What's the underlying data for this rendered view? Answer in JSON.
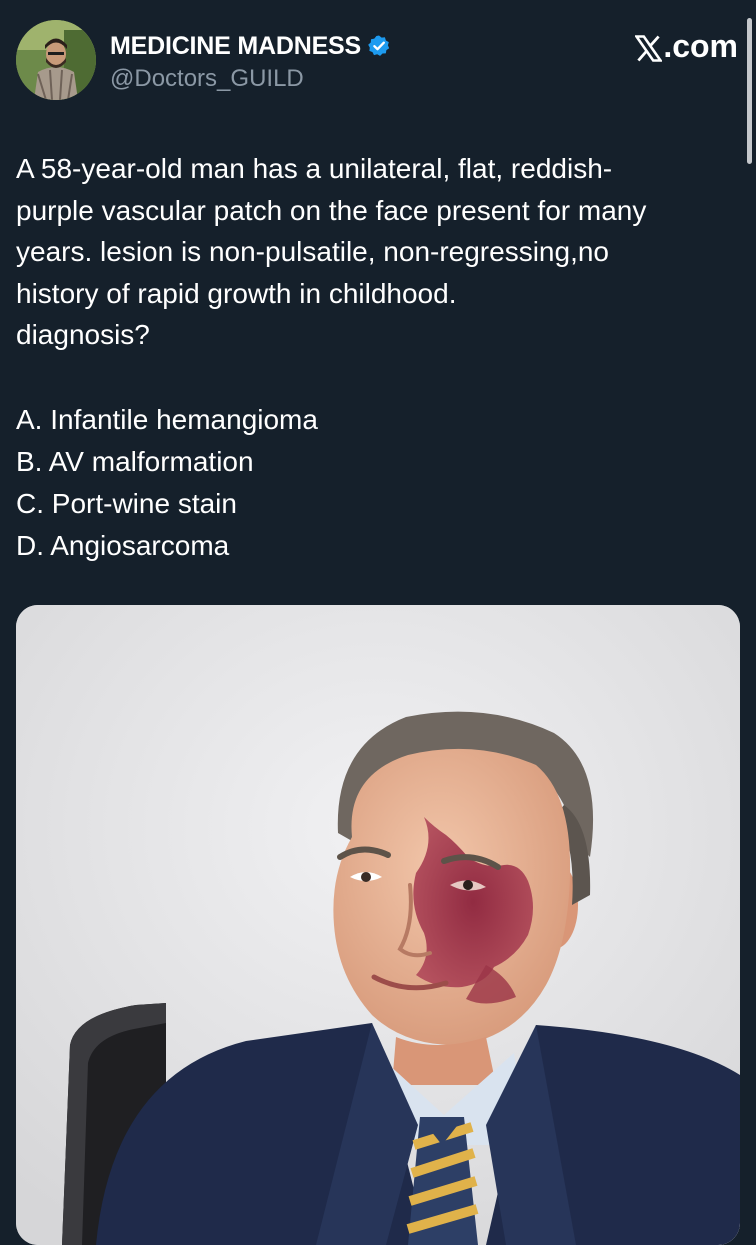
{
  "author": {
    "display_name": "MEDICINE MADNESS",
    "handle": "@Doctors_GUILD",
    "verified_color": "#1d9bf0"
  },
  "brand": {
    "label": ".com",
    "icon": "x-logo-icon"
  },
  "post": {
    "text_lines": [
      "A 58-year-old man has a unilateral, flat, reddish-",
      "purple vascular patch on the face present for many",
      "years. lesion is non-pulsatile, non-regressing,no",
      "history of rapid growth in childhood.",
      "diagnosis?"
    ],
    "options": [
      "A. Infantile hemangioma",
      "B. AV malformation",
      "C. Port-wine stain",
      "D. Angiosarcoma"
    ]
  },
  "colors": {
    "background": "#15202b",
    "text": "#ffffff",
    "secondary_text": "#8b98a5"
  }
}
